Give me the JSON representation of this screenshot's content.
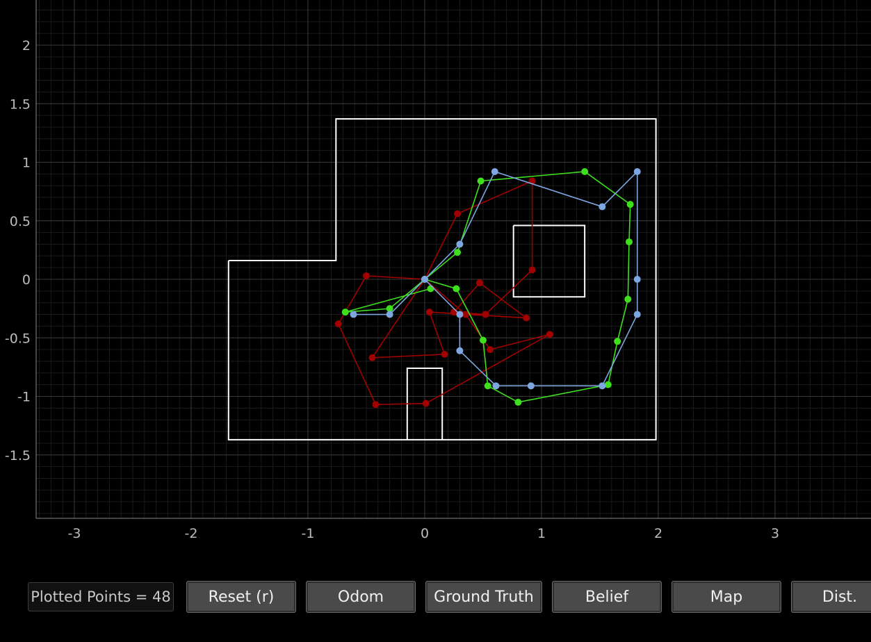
{
  "toolbar": {
    "counter_label": "Plotted Points = 48",
    "buttons": {
      "reset": "Reset (r)",
      "odom": "Odom",
      "ground_truth": "Ground Truth",
      "belief": "Belief",
      "map": "Map",
      "dist": "Dist."
    }
  },
  "colors": {
    "background": "#000000",
    "odom": "#a00000",
    "ground_truth": "#3ee01e",
    "belief": "#7ea6e0",
    "map": "#ffffff"
  },
  "chart_data": {
    "type": "scatter",
    "title": "",
    "xlabel": "",
    "ylabel": "",
    "xlim": [
      -3.35,
      3.8
    ],
    "ylim": [
      -2.0,
      2.38
    ],
    "x_ticks": [
      -3,
      -2,
      -1,
      0,
      1,
      2,
      3
    ],
    "y_ticks": [
      2,
      1.5,
      1,
      0.5,
      0,
      -0.5,
      -1,
      -1.5
    ],
    "grid": true,
    "series": [
      {
        "key": "odom",
        "color": "#a00000",
        "points": [
          [
            0.0,
            0.0
          ],
          [
            0.28,
            0.56
          ],
          [
            0.92,
            0.84
          ],
          [
            0.92,
            0.08
          ],
          [
            0.52,
            -0.3
          ],
          [
            0.25,
            -0.28
          ],
          [
            0.47,
            -0.03
          ],
          [
            0.87,
            -0.33
          ],
          [
            0.04,
            -0.28
          ],
          [
            0.17,
            -0.64
          ],
          [
            -0.45,
            -0.67
          ],
          [
            0.0,
            0.0
          ],
          [
            -0.5,
            0.03
          ],
          [
            -0.74,
            -0.38
          ],
          [
            -0.42,
            -1.07
          ],
          [
            0.01,
            -1.06
          ],
          [
            1.07,
            -0.47
          ],
          [
            0.56,
            -0.6
          ],
          [
            0.35,
            -0.3
          ],
          [
            0.0,
            0.0
          ]
        ]
      },
      {
        "key": "ground_truth",
        "color": "#3ee01e",
        "points": [
          [
            0.0,
            0.0
          ],
          [
            0.28,
            0.23
          ],
          [
            0.48,
            0.84
          ],
          [
            1.37,
            0.92
          ],
          [
            1.76,
            0.64
          ],
          [
            1.75,
            0.32
          ],
          [
            1.74,
            -0.17
          ],
          [
            1.65,
            -0.53
          ],
          [
            1.57,
            -0.9
          ],
          [
            0.8,
            -1.05
          ],
          [
            0.54,
            -0.91
          ],
          [
            0.5,
            -0.52
          ],
          [
            0.27,
            -0.08
          ],
          [
            0.0,
            0.0
          ],
          [
            -0.3,
            -0.25
          ],
          [
            -0.68,
            -0.28
          ],
          [
            0.05,
            -0.08
          ]
        ]
      },
      {
        "key": "belief",
        "color": "#7ea6e0",
        "points": [
          [
            0.0,
            0.0
          ],
          [
            0.3,
            0.3
          ],
          [
            0.6,
            0.92
          ],
          [
            1.52,
            0.62
          ],
          [
            1.82,
            0.92
          ],
          [
            1.82,
            0.0
          ],
          [
            1.82,
            -0.3
          ],
          [
            1.52,
            -0.91
          ],
          [
            0.91,
            -0.91
          ],
          [
            0.61,
            -0.91
          ],
          [
            0.3,
            -0.61
          ],
          [
            0.3,
            -0.3
          ],
          [
            0.0,
            0.0
          ],
          [
            -0.3,
            -0.3
          ],
          [
            -0.61,
            -0.3
          ]
        ]
      }
    ],
    "map_walls": [
      [
        [
          -1.68,
          0.16
        ],
        [
          -0.76,
          0.16
        ],
        [
          -0.76,
          1.37
        ],
        [
          1.98,
          1.37
        ],
        [
          1.98,
          -1.37
        ],
        [
          -1.68,
          -1.37
        ],
        [
          -1.68,
          0.16
        ]
      ],
      [
        [
          0.76,
          0.46
        ],
        [
          1.37,
          0.46
        ],
        [
          1.37,
          -0.15
        ],
        [
          0.76,
          -0.15
        ],
        [
          0.76,
          0.46
        ]
      ],
      [
        [
          -0.15,
          -1.37
        ],
        [
          -0.15,
          -0.76
        ],
        [
          0.15,
          -0.76
        ],
        [
          0.15,
          -1.37
        ]
      ]
    ]
  }
}
